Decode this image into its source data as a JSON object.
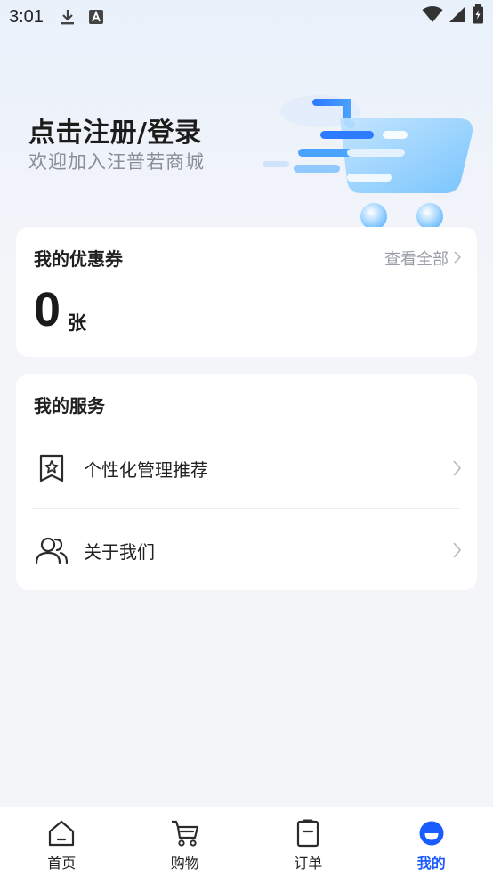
{
  "status_bar": {
    "time": "3:01"
  },
  "header": {
    "login_title": "点击注册/登录",
    "login_subtitle": "欢迎加入汪普若商城"
  },
  "coupon": {
    "title": "我的优惠券",
    "view_all": "查看全部",
    "count": "0",
    "unit": "张"
  },
  "services": {
    "title": "我的服务",
    "items": [
      {
        "label": "个性化管理推荐",
        "icon": "bookmark-star-icon"
      },
      {
        "label": "关于我们",
        "icon": "users-icon"
      }
    ]
  },
  "tabbar": {
    "items": [
      {
        "label": "首页",
        "icon": "home-icon",
        "active": false
      },
      {
        "label": "购物",
        "icon": "cart-icon",
        "active": false
      },
      {
        "label": "订单",
        "icon": "order-icon",
        "active": false
      },
      {
        "label": "我的",
        "icon": "profile-icon",
        "active": true
      }
    ]
  },
  "colors": {
    "accent": "#1a5cff",
    "page_background": "#f4f5f9",
    "card_background": "#ffffff",
    "muted_text": "#9a9ea6"
  }
}
